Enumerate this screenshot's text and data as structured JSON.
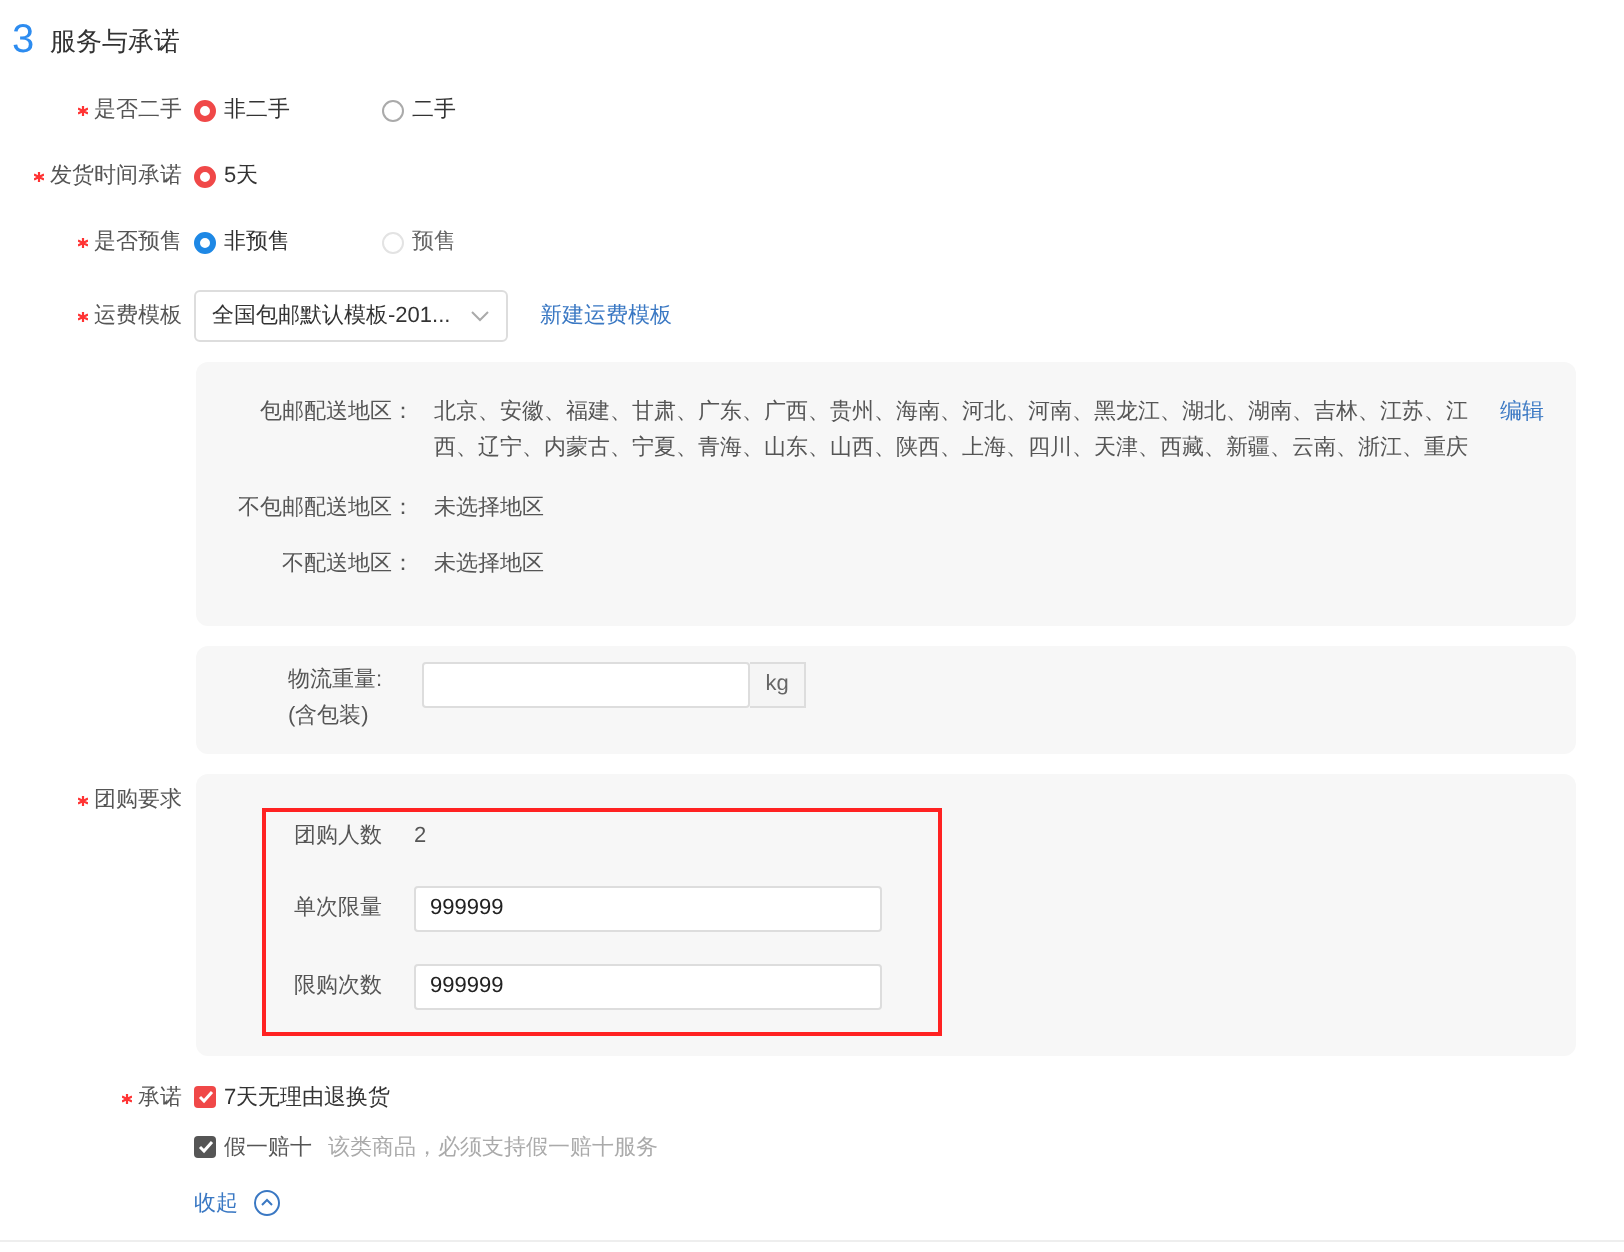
{
  "section": {
    "number": "3",
    "title": "服务与承诺"
  },
  "fields": [
    {
      "kind": "radio",
      "label": "是否二手",
      "required": true,
      "color": "#f04848",
      "options": [
        {
          "label": "非二手",
          "selected": true,
          "disabled": false
        },
        {
          "label": "二手",
          "selected": false,
          "disabled": false
        }
      ]
    },
    {
      "kind": "radio",
      "label": "发货时间承诺",
      "required": true,
      "color": "#f04848",
      "options": [
        {
          "label": "5天",
          "selected": true,
          "disabled": false
        }
      ]
    },
    {
      "kind": "radio",
      "label": "是否预售",
      "required": true,
      "color": "#1e88e5",
      "options": [
        {
          "label": "非预售",
          "selected": true,
          "disabled": false
        },
        {
          "label": "预售",
          "selected": false,
          "disabled": true
        }
      ]
    },
    {
      "kind": "select",
      "label": "运费模板",
      "required": true,
      "value": "全国包邮默认模板-201...",
      "link": "新建运费模板"
    }
  ],
  "shipping": {
    "rows": [
      {
        "label": "包邮配送地区：",
        "value": "北京、安徽、福建、甘肃、广东、广西、贵州、海南、河北、河南、黑龙江、湖北、湖南、吉林、江苏、江西、辽宁、内蒙古、宁夏、青海、山东、山西、陕西、上海、四川、天津、西藏、新疆、云南、浙江、重庆",
        "action": "编辑"
      },
      {
        "label": "不包邮配送地区：",
        "value": "未选择地区"
      },
      {
        "label": "不配送地区：",
        "value": "未选择地区"
      }
    ]
  },
  "weight": {
    "label_lines": [
      "物流重量:",
      "(含包装)"
    ],
    "unit": "kg"
  },
  "group_buy": {
    "label": "团购要求",
    "required": true,
    "highlighted": true,
    "rows": [
      {
        "kind": "text",
        "label": "团购人数",
        "value": "2"
      },
      {
        "kind": "input",
        "label": "单次限量",
        "value": "999999"
      },
      {
        "kind": "input",
        "label": "限购次数",
        "value": "999999"
      }
    ]
  },
  "commitment": {
    "label": "承诺",
    "required": true,
    "items": [
      {
        "label": "7天无理由退换货",
        "checked": true,
        "disabled": false
      },
      {
        "label": "假一赔十",
        "checked": true,
        "disabled": true,
        "hint": "该类商品，必须支持假一赔十服务"
      }
    ]
  },
  "collapse": {
    "label": "收起"
  }
}
